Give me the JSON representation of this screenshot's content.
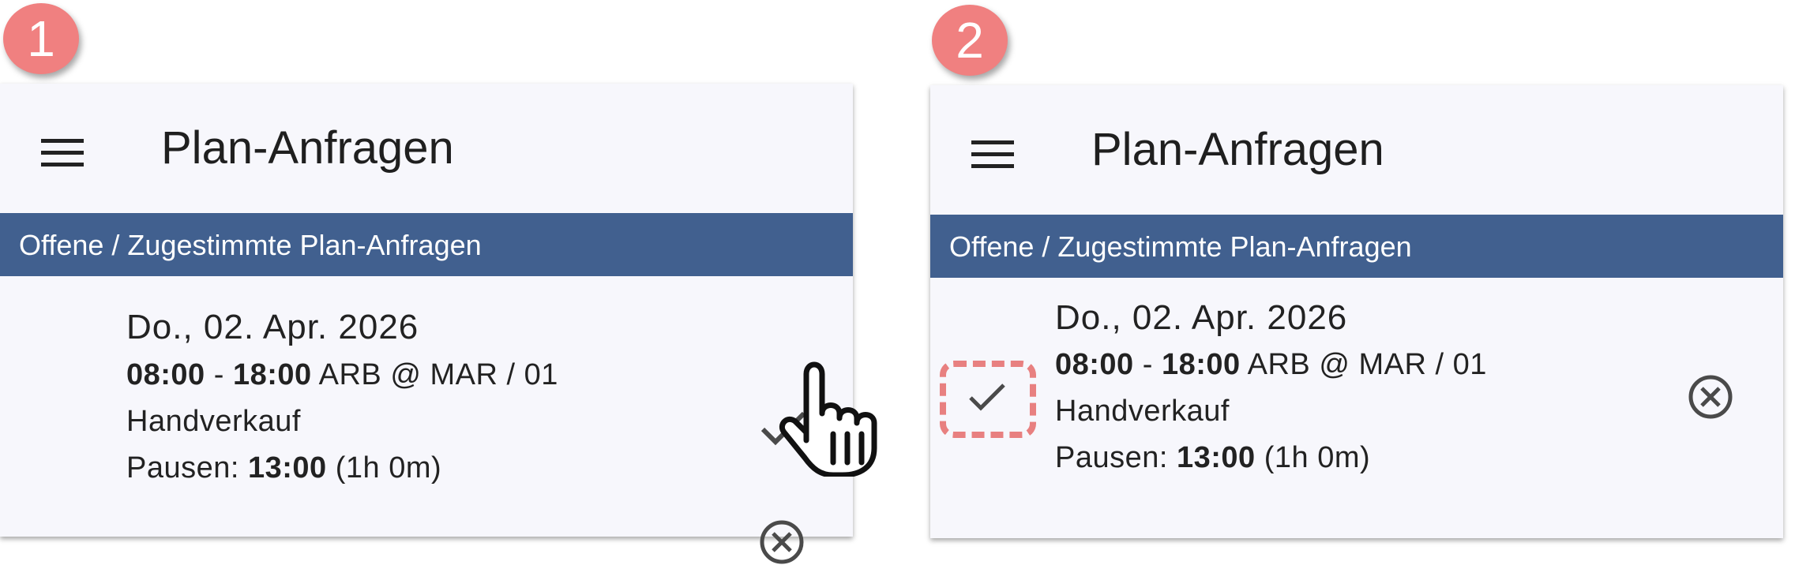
{
  "steps": [
    {
      "badge": "1",
      "appbar": {
        "title": "Plan-Anfragen",
        "menu_icon": "menu-icon"
      },
      "section": {
        "label": "Offene / Zugestimmte Plan-Anfragen"
      },
      "request": {
        "date": "Do., 02. Apr. 2026",
        "time_start": "08:00",
        "time_sep": " - ",
        "time_end": "18:00",
        "location": " ARB @ MAR / 01",
        "activity": "Handverkauf",
        "break_label": "Pausen: ",
        "break_time": "13:00",
        "break_duration": " (1h 0m)"
      },
      "actions": {
        "approve_icon": "check-icon",
        "reject_icon": "cancel-circle-icon"
      },
      "annotation": "pointing-hand-cursor"
    },
    {
      "badge": "2",
      "appbar": {
        "title": "Plan-Anfragen",
        "menu_icon": "menu-icon"
      },
      "section": {
        "label": "Offene / Zugestimmte Plan-Anfragen"
      },
      "request": {
        "date": "Do., 02. Apr. 2026",
        "time_start": "08:00",
        "time_sep": " - ",
        "time_end": "18:00",
        "location": " ARB @ MAR / 01",
        "activity": "Handverkauf",
        "break_label": "Pausen: ",
        "break_time": "13:00",
        "break_duration": " (1h 0m)"
      },
      "actions": {
        "approved_icon": "check-icon",
        "reject_icon": "cancel-circle-icon"
      },
      "annotation": "dashed-highlight-box"
    }
  ],
  "colors": {
    "badge": "#f08080",
    "section_bar": "#41608f",
    "panel_bg": "#f7f7fc",
    "icon_gray": "#4a4a4a",
    "highlight": "#e88080"
  }
}
